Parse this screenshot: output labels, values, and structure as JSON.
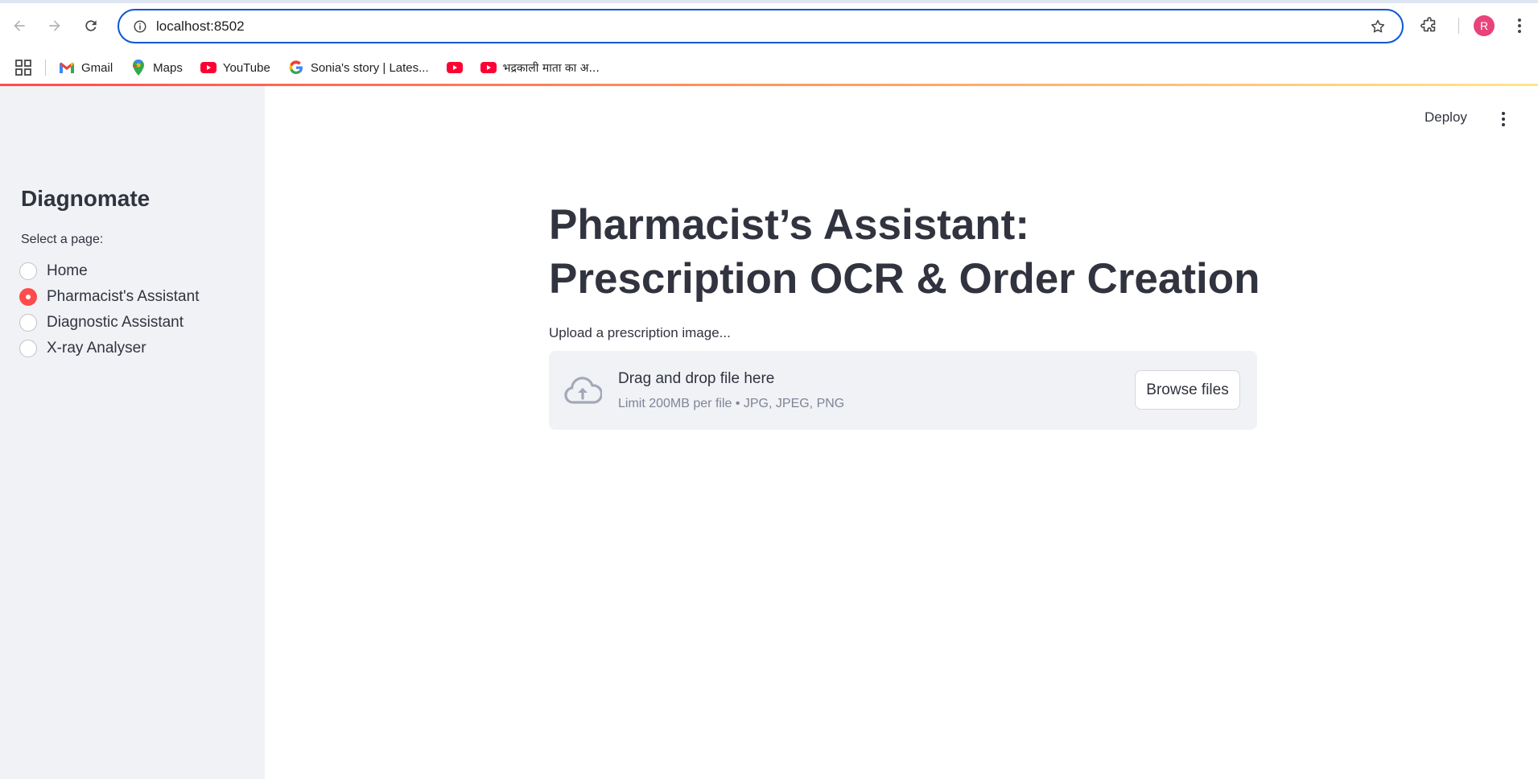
{
  "browser": {
    "url": "localhost:8502",
    "profile_initial": "R",
    "bookmarks": [
      {
        "label": "Gmail",
        "icon": "gmail-icon"
      },
      {
        "label": "Maps",
        "icon": "maps-icon"
      },
      {
        "label": "YouTube",
        "icon": "youtube-icon"
      },
      {
        "label": "Sonia's story | Lates...",
        "icon": "google-icon"
      },
      {
        "label": "",
        "icon": "youtube-icon"
      },
      {
        "label": "भद्रकाली माता का अ...",
        "icon": "youtube-icon"
      }
    ]
  },
  "sidebar": {
    "title": "Diagnomate",
    "select_label": "Select a page:",
    "options": [
      {
        "label": "Home",
        "checked": false
      },
      {
        "label": "Pharmacist's Assistant",
        "checked": true
      },
      {
        "label": "Diagnostic Assistant",
        "checked": false
      },
      {
        "label": "X-ray Analyser",
        "checked": false
      }
    ]
  },
  "header": {
    "deploy_label": "Deploy"
  },
  "main": {
    "title": "Pharmacist’s Assistant: Prescription OCR & Order Creation",
    "upload_label": "Upload a prescription image...",
    "dropzone": {
      "title": "Drag and drop file here",
      "limit": "Limit 200MB per file • JPG, JPEG, PNG",
      "browse_label": "Browse files"
    }
  },
  "colors": {
    "accent": "#ff4b4b",
    "sidebar_bg": "#f0f2f6",
    "text": "#31333f",
    "omnibox_border": "#0b57d0"
  }
}
